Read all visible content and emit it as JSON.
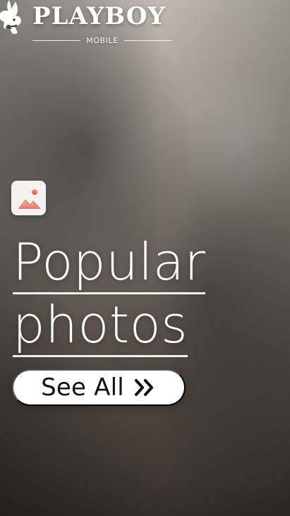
{
  "brand": {
    "wordmark": "PLAYBOY",
    "subtitle": "MOBILE"
  },
  "hero": {
    "section_icon": "image-gallery-icon",
    "heading_line_1": "Popular",
    "heading_line_2": "photos",
    "cta_label": "See All",
    "cta_icon": "double-chevron-right-icon"
  },
  "colors": {
    "text_primary": "#ffffff",
    "button_bg": "#ffffff",
    "button_text": "#111111",
    "icon_gradient_top": "#f6a07f",
    "icon_gradient_bottom": "#e04b4b"
  }
}
